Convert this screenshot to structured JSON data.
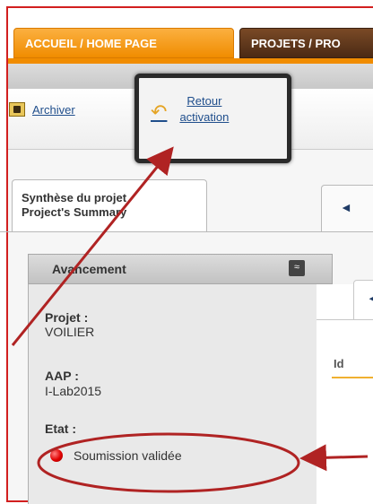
{
  "top_tabs": [
    {
      "label": "ACCUEIL / HOME PAGE"
    },
    {
      "label": "PROJETS / PRO"
    }
  ],
  "toolbar": {
    "archive_label": "Archiver",
    "retour_line1": "Retour",
    "retour_line2": "activation"
  },
  "sub_tabs": {
    "summary_line1": "Synthèse du projet",
    "summary_line2": "Project's Summary",
    "nav_arrow": "◄"
  },
  "panel": {
    "title": "Avancement",
    "collapse_glyph": "≈",
    "fields": [
      {
        "label": "Projet :",
        "value": "VOILIER"
      },
      {
        "label": "AAP :",
        "value": "I-Lab2015"
      },
      {
        "label": "Etat :"
      }
    ],
    "status_text": "Soumission validée",
    "status_color": "#e00000"
  },
  "right": {
    "tab_arrow": "◄",
    "id_label": "Id"
  },
  "colors": {
    "frame": "#d21f1f",
    "accent_orange": "#f08c00",
    "annotation": "#b02323"
  }
}
